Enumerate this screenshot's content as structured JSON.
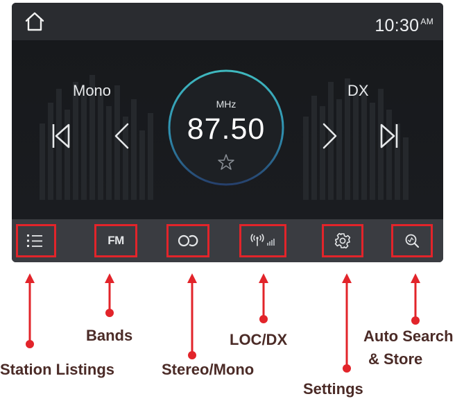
{
  "statusbar": {
    "time": "10:30",
    "time_suffix": "AM"
  },
  "main": {
    "mono_label": "Mono",
    "dx_label": "DX",
    "unit": "MHz",
    "frequency": "87.50"
  },
  "bottombar": {
    "band_label": "FM"
  },
  "callouts": {
    "station_listings": "Station Listings",
    "bands": "Bands",
    "stereo_mono": "Stereo/Mono",
    "loc_dx": "LOC/DX",
    "settings": "Settings",
    "auto_search_line1": "Auto Search",
    "auto_search_line2": "& Store"
  },
  "colors": {
    "screen_bg": "#1b1d21",
    "bar_bg": "#3a3c41",
    "highlight": "#e2242a",
    "callout_text": "#4b2b27",
    "ring": "#3cb8c0"
  },
  "icons": [
    "home-icon",
    "skip-previous-icon",
    "chevron-left-icon",
    "chevron-right-icon",
    "skip-next-icon",
    "star-icon",
    "list-icon",
    "stereo-icon",
    "antenna-icon",
    "gear-icon",
    "search-icon"
  ]
}
